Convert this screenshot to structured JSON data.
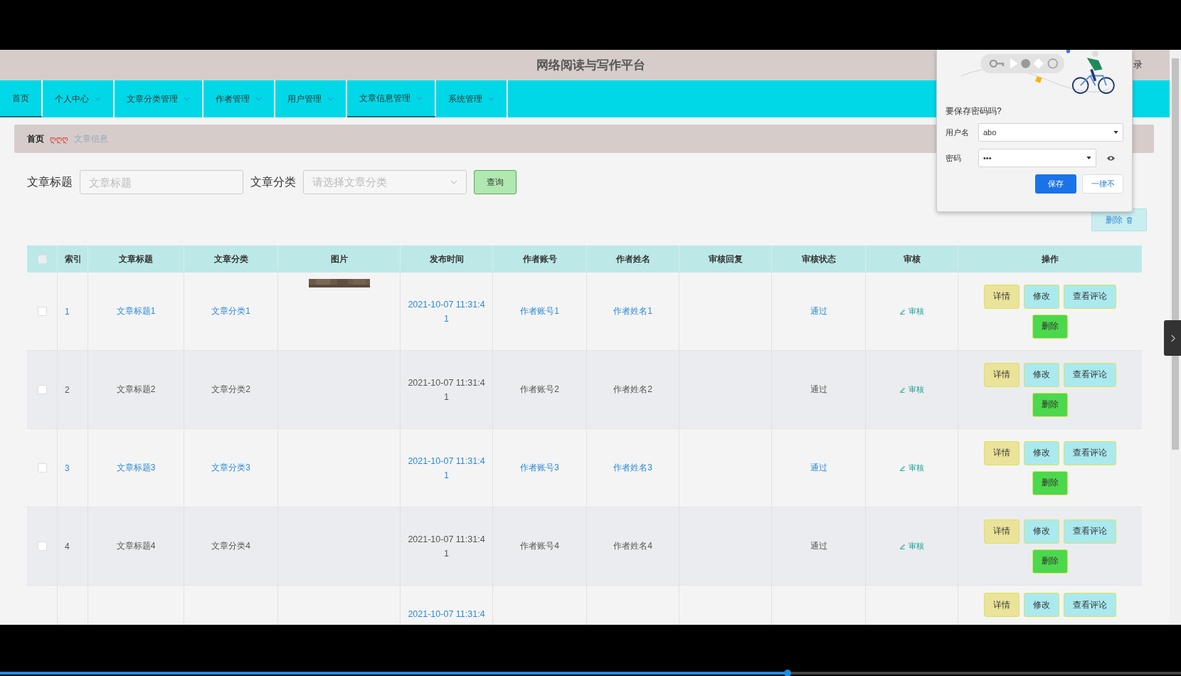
{
  "header": {
    "title": "网络阅读与写作平台",
    "right_text": "录"
  },
  "nav": [
    {
      "label": "首页",
      "has_menu": false,
      "selected": true
    },
    {
      "label": "个人中心",
      "has_menu": true,
      "selected": false
    },
    {
      "label": "文章分类管理",
      "has_menu": true,
      "selected": false
    },
    {
      "label": "作者管理",
      "has_menu": true,
      "selected": false
    },
    {
      "label": "用户管理",
      "has_menu": true,
      "selected": false
    },
    {
      "label": "文章信息管理",
      "has_menu": true,
      "selected": true
    },
    {
      "label": "系统管理",
      "has_menu": true,
      "selected": false
    }
  ],
  "breadcrumb": {
    "home": "首页",
    "separator": "ღღღ",
    "current": "文章信息"
  },
  "search": {
    "title_label": "文章标题",
    "title_placeholder": "文章标题",
    "category_label": "文章分类",
    "category_placeholder": "请选择文章分类",
    "query_button": "查询"
  },
  "delete_button": "删除",
  "table": {
    "select_all_checked": false,
    "columns": [
      "索引",
      "文章标题",
      "文章分类",
      "图片",
      "发布时间",
      "作者账号",
      "作者姓名",
      "审核回复",
      "审核状态",
      "审核",
      "操作"
    ],
    "rows": [
      {
        "kind": "link",
        "checked": false,
        "index": "1",
        "title": "文章标题1",
        "category": "文章分类1",
        "picture": true,
        "time": [
          "2021-10-07 11:31:4",
          "1"
        ],
        "account": "作者账号1",
        "name": "作者姓名1",
        "status": "通过",
        "review": "审核",
        "actions": [
          "详情",
          "修改",
          "查看评论",
          "删除"
        ]
      },
      {
        "kind": "plain",
        "checked": false,
        "index": "2",
        "title": "文章标题2",
        "category": "文章分类2",
        "picture": false,
        "time": [
          "2021-10-07 11:31:4",
          "1"
        ],
        "account": "作者账号2",
        "name": "作者姓名2",
        "status": "通过",
        "review": "审核",
        "actions": [
          "详情",
          "修改",
          "查看评论",
          "删除"
        ]
      },
      {
        "kind": "link",
        "checked": false,
        "index": "3",
        "title": "文章标题3",
        "category": "文章分类3",
        "picture": false,
        "time": [
          "2021-10-07 11:31:4",
          "1"
        ],
        "account": "作者账号3",
        "name": "作者姓名3",
        "status": "通过",
        "review": "审核",
        "actions": [
          "详情",
          "修改",
          "查看评论",
          "删除"
        ]
      },
      {
        "kind": "plain",
        "checked": false,
        "index": "4",
        "title": "文章标题4",
        "category": "文章分类4",
        "picture": false,
        "time": [
          "2021-10-07 11:31:4",
          "1"
        ],
        "account": "作者账号4",
        "name": "作者姓名4",
        "status": "通过",
        "review": "审核",
        "actions": [
          "详情",
          "修改",
          "查看评论",
          "删除"
        ]
      },
      {
        "kind": "link",
        "picture": false,
        "time": [
          "2021-10-07 11:31:4"
        ],
        "actions": [
          "详情",
          "修改",
          "查看评论"
        ]
      }
    ]
  },
  "password_popup": {
    "question": "要保存密码吗?",
    "username_label": "用户名",
    "username": "abo",
    "password_label": "密码",
    "password": "•••",
    "save_button": "保存",
    "never_button": "一律不"
  },
  "video_progress": {
    "level": 0.667
  }
}
